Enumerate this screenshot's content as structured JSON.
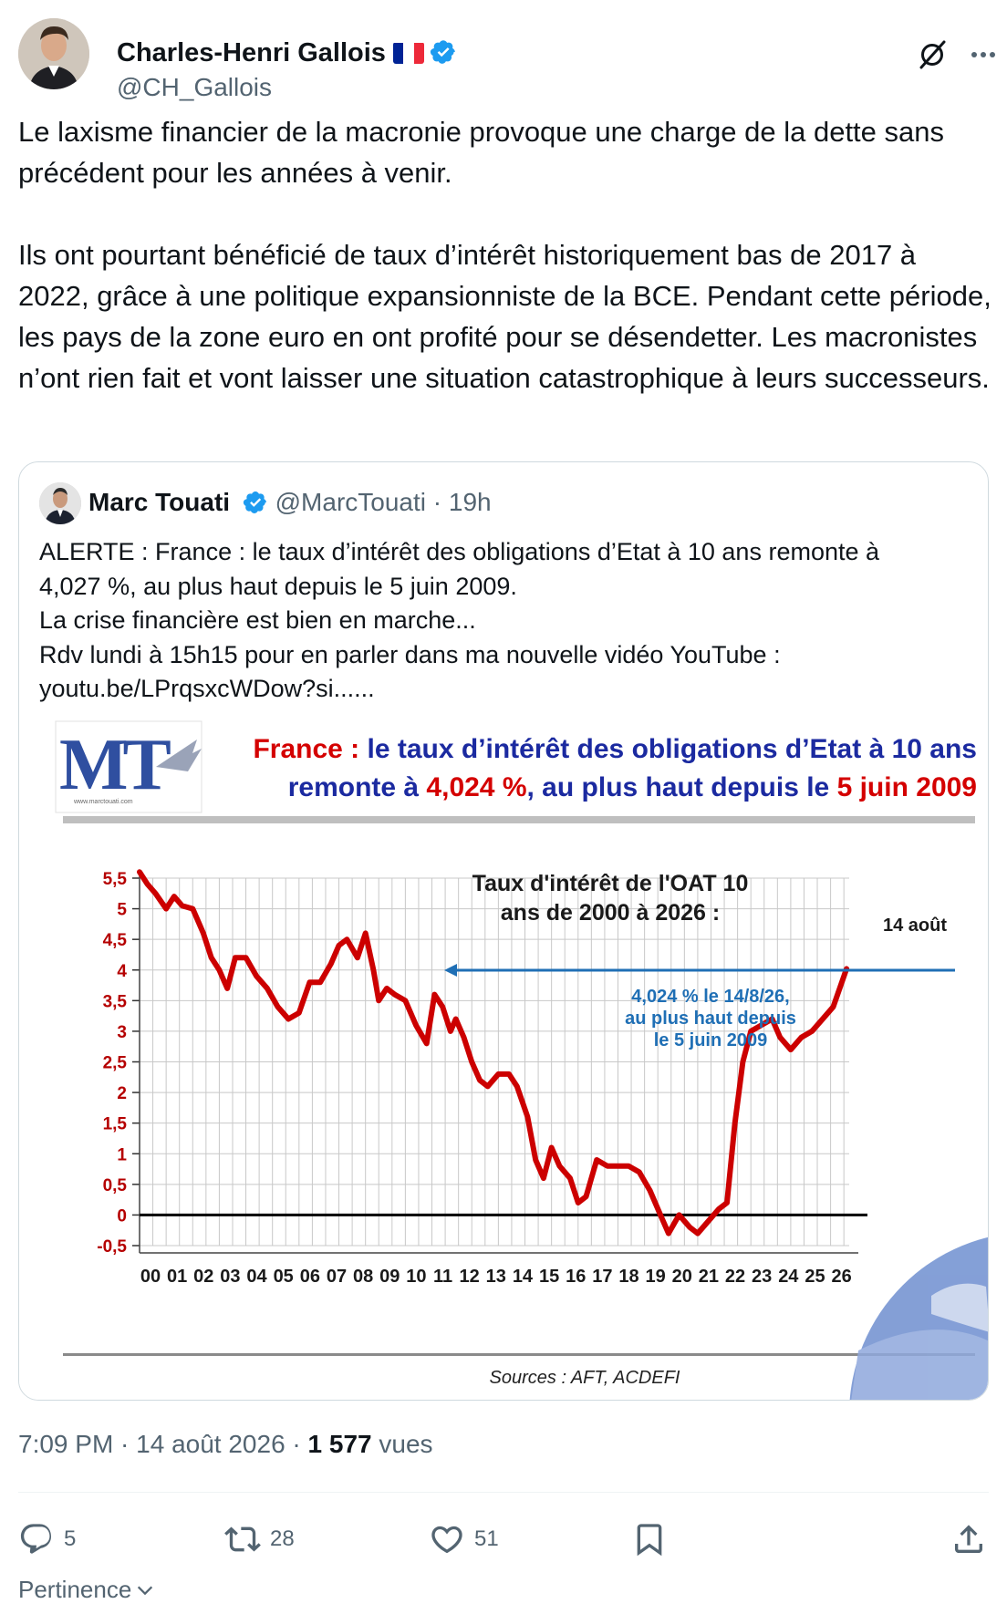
{
  "author": {
    "name": "Charles-Henri Gallois",
    "handle": "@CH_Gallois",
    "verified": true,
    "flag_colors": [
      "#002395",
      "#ffffff",
      "#ed2939"
    ]
  },
  "tweet": {
    "paragraphs": [
      "Le laxisme financier de la macronie provoque une charge de la dette sans précédent pour les années à venir.",
      "Ils ont pourtant bénéficié de taux d’intérêt historiquement bas de 2017 à 2022, grâce à une politique expansionniste de la BCE. Pendant cette période, les pays de la zone euro en ont profité pour se désendetter. Les macronistes n’ont rien fait et vont laisser une situation catastrophique à leurs successeurs."
    ]
  },
  "quoted": {
    "name": "Marc Touati",
    "handle": "@MarcTouati",
    "time": "· 19h",
    "verified": true,
    "lines": [
      "ALERTE : France : le taux d’intérêt des obligations d’Etat à 10 ans remonte à",
      "4,027 %, au plus haut depuis le 5 juin 2009.",
      "La crise financière est bien en marche...",
      "Rdv lundi à 15h15 pour en parler dans ma nouvelle vidéo YouTube :",
      "youtu.be/LPrqsxcWDow?si......"
    ]
  },
  "figure": {
    "logo_text": "MT",
    "logo_site": "www.marctouati.com",
    "headline_1_red": "France :",
    "headline_1_blue": " le taux d’intérêt des obligations d’Etat à 10 ans",
    "headline_2_blue_a": "remonte à ",
    "headline_2_red_a": "4,024 %",
    "headline_2_blue_b": ", au plus haut depuis le ",
    "headline_2_red_b": "5 juin 2009",
    "chart_title_1": "Taux d'intérêt de l'OAT 10",
    "chart_title_2": "ans de 2000 à 2026 :",
    "date_label": "14 août",
    "annotation": [
      "4,024 % le 14/8/26,",
      "au plus haut depuis",
      "le 5 juin 2009"
    ],
    "source": "Sources : AFT, ACDEFI",
    "colors": {
      "line": "#cc0000",
      "arrow": "#1f6fb5",
      "blue_text": "#1b2aa0",
      "red_text": "#d40000"
    }
  },
  "chart_data": {
    "type": "line",
    "title": "Taux d'intérêt de l'OAT 10 ans de 2000 à 2026 :",
    "xlabel": "",
    "ylabel": "",
    "ylim": [
      -0.5,
      5.5
    ],
    "xlim": [
      2000,
      2026.7
    ],
    "grid": true,
    "y_ticks": [
      "5,5",
      "5",
      "4,5",
      "4",
      "3,5",
      "3",
      "2,5",
      "2",
      "1,5",
      "1",
      "0,5",
      "0",
      "-0,5"
    ],
    "x_ticks": [
      "00",
      "01",
      "02",
      "03",
      "04",
      "05",
      "06",
      "07",
      "08",
      "09",
      "10",
      "11",
      "12",
      "13",
      "14",
      "15",
      "16",
      "17",
      "18",
      "19",
      "20",
      "21",
      "22",
      "23",
      "24",
      "25",
      "26"
    ],
    "series": [
      {
        "x": [
          2000.0,
          2000.3,
          2000.6,
          2001.0,
          2001.3,
          2001.6,
          2002.0,
          2002.4,
          2002.7,
          2003.0,
          2003.3,
          2003.6,
          2004.0,
          2004.4,
          2004.8,
          2005.2,
          2005.6,
          2006.0,
          2006.4,
          2006.8,
          2007.2,
          2007.5,
          2007.8,
          2008.2,
          2008.5,
          2008.8,
          2009.0,
          2009.3,
          2009.6,
          2010.0,
          2010.4,
          2010.8,
          2011.1,
          2011.4,
          2011.7,
          2011.9,
          2012.2,
          2012.5,
          2012.8,
          2013.1,
          2013.5,
          2013.9,
          2014.2,
          2014.6,
          2014.9,
          2015.2,
          2015.5,
          2015.8,
          2016.2,
          2016.5,
          2016.8,
          2017.2,
          2017.6,
          2018.0,
          2018.4,
          2018.8,
          2019.2,
          2019.6,
          2019.9,
          2020.3,
          2020.7,
          2021.0,
          2021.4,
          2021.8,
          2022.1,
          2022.4,
          2022.7,
          2023.0,
          2023.4,
          2023.8,
          2024.1,
          2024.5,
          2024.9,
          2025.3,
          2025.7,
          2026.1,
          2026.6
        ],
        "y": [
          5.6,
          5.4,
          5.25,
          5.0,
          5.2,
          5.05,
          5.0,
          4.6,
          4.2,
          4.0,
          3.7,
          4.2,
          4.2,
          3.9,
          3.7,
          3.4,
          3.2,
          3.3,
          3.8,
          3.8,
          4.1,
          4.4,
          4.5,
          4.2,
          4.6,
          4.0,
          3.5,
          3.7,
          3.6,
          3.5,
          3.1,
          2.8,
          3.6,
          3.4,
          3.0,
          3.2,
          2.9,
          2.5,
          2.2,
          2.1,
          2.3,
          2.3,
          2.1,
          1.6,
          0.9,
          0.6,
          1.1,
          0.8,
          0.6,
          0.2,
          0.3,
          0.9,
          0.8,
          0.8,
          0.8,
          0.7,
          0.4,
          0.0,
          -0.3,
          0.0,
          -0.2,
          -0.3,
          -0.1,
          0.1,
          0.2,
          1.5,
          2.5,
          3.0,
          3.1,
          3.2,
          2.9,
          2.7,
          2.9,
          3.0,
          3.2,
          3.4,
          4.02
        ]
      }
    ]
  },
  "meta": {
    "time": "7:09 PM · 14 août 2026 · ",
    "views": "1 577",
    "views_label": " vues"
  },
  "actions": {
    "replies": "5",
    "reposts": "28",
    "likes": "51"
  },
  "sort": {
    "label": "Pertinence"
  }
}
